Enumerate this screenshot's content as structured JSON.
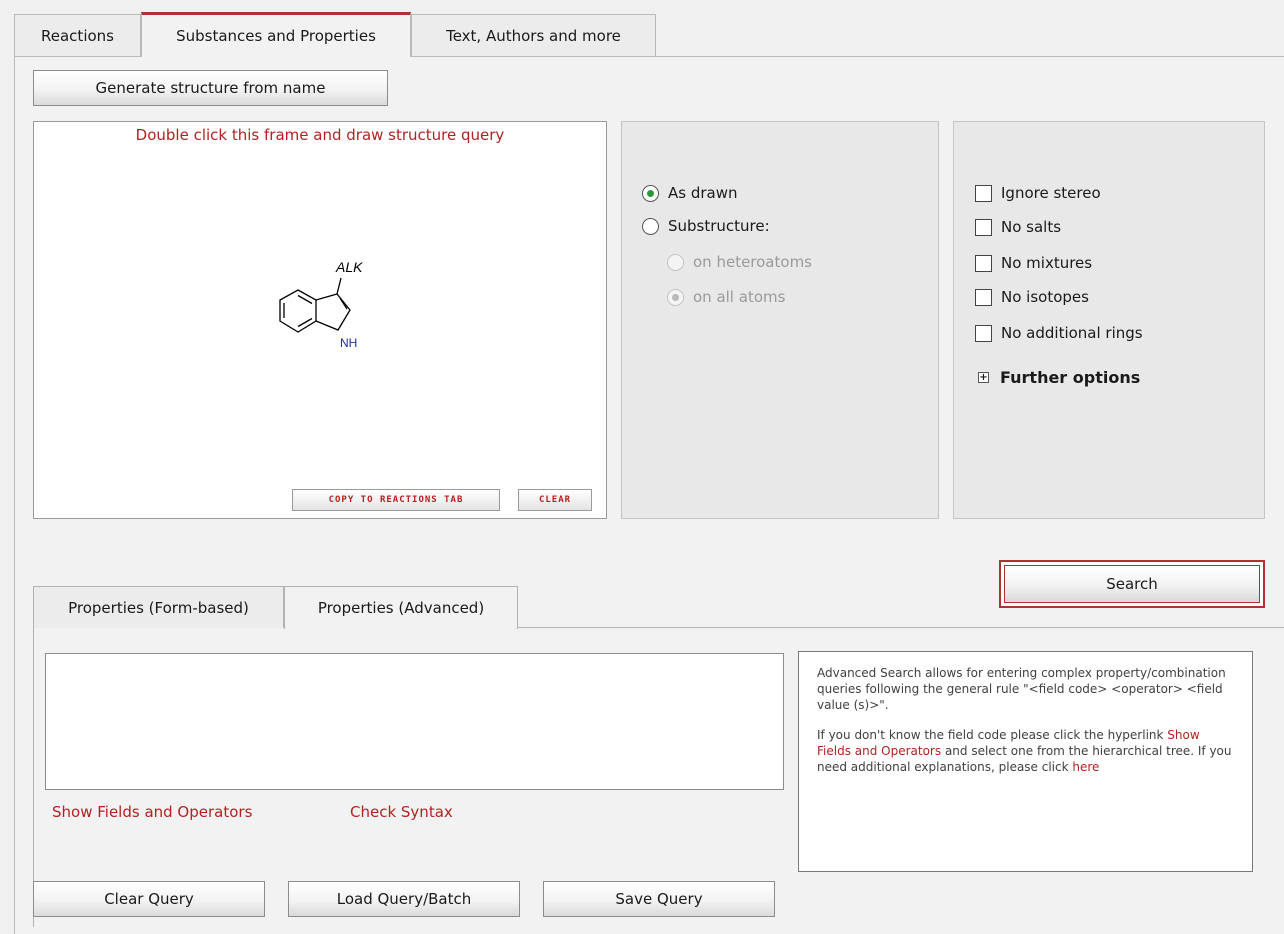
{
  "tabs": {
    "reactions": "Reactions",
    "substances": "Substances and Properties",
    "text_authors": "Text, Authors and more"
  },
  "buttons": {
    "generate": "Generate structure from name",
    "copy_to_reactions": "COPY TO REACTIONS TAB",
    "clear": "CLEAR",
    "search": "Search",
    "clear_query": "Clear Query",
    "load_query": "Load Query/Batch",
    "save_query": "Save Query"
  },
  "structure": {
    "hint": "Double click this frame and draw structure query",
    "alk_label": "ALK",
    "nh_label": "NH"
  },
  "match_options": {
    "as_drawn": "As drawn",
    "substructure": "Substructure:",
    "on_heteroatoms": "on heteroatoms",
    "on_all_atoms": "on all atoms"
  },
  "filter_options": {
    "ignore_stereo": "Ignore stereo",
    "no_salts": "No salts",
    "no_mixtures": "No mixtures",
    "no_isotopes": "No isotopes",
    "no_additional_rings": "No additional rings",
    "further_options": "Further options"
  },
  "property_tabs": {
    "form_based": "Properties (Form-based)",
    "advanced": "Properties (Advanced)"
  },
  "links": {
    "show_fields": "Show Fields and Operators",
    "check_syntax": "Check Syntax"
  },
  "help": {
    "p1": "Advanced Search allows for entering complex property/combination queries following the general rule \"<field code> <operator> <field value (s)>\".",
    "p2_a": "If you don't know the field code please click the hyperlink ",
    "p2_link": "Show Fields and Operators",
    "p2_b": " and select one from the hierarchical tree. If you need additional explanations, please click ",
    "p2_here": "here"
  },
  "colors": {
    "accent": "#b22222",
    "radio_checked": "#2a9a34"
  }
}
